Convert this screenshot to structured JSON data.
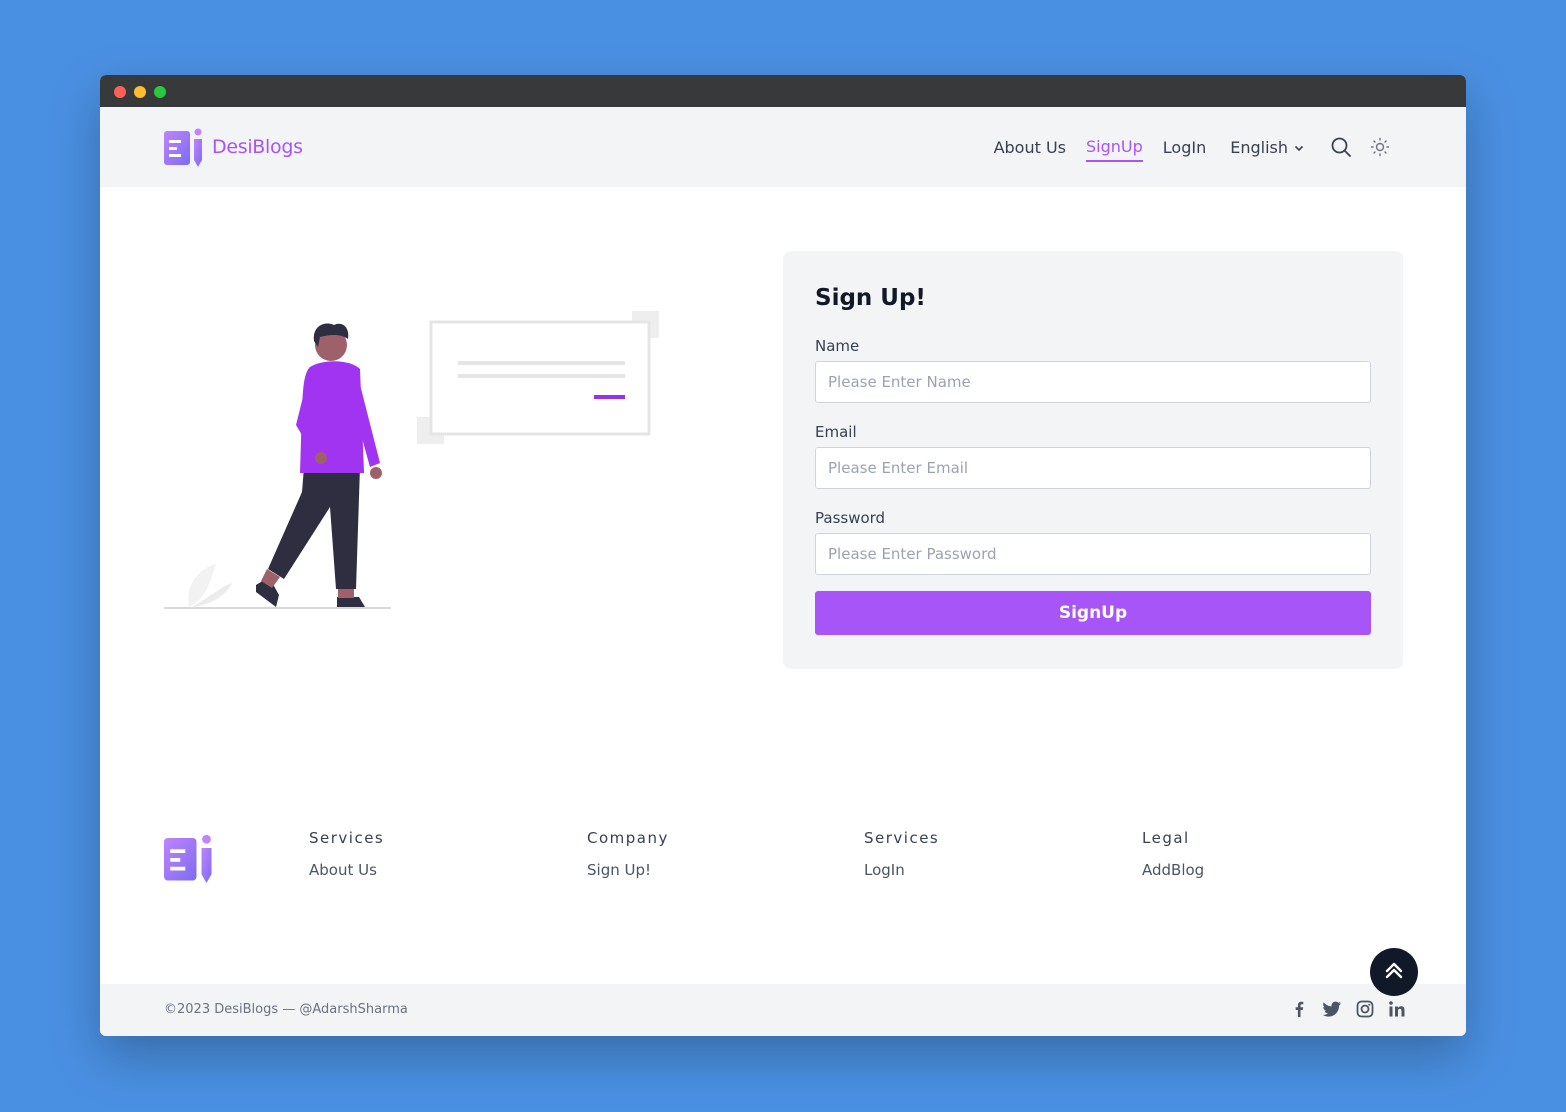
{
  "brand": {
    "name": "DesiBlogs",
    "accent": "#a855f7"
  },
  "nav": {
    "links": [
      "About Us",
      "SignUp",
      "LogIn"
    ],
    "active": "SignUp",
    "language": "English"
  },
  "signup": {
    "title": "Sign Up!",
    "name_label": "Name",
    "name_placeholder": "Please Enter Name",
    "email_label": "Email",
    "email_placeholder": "Please Enter Email",
    "password_label": "Password",
    "password_placeholder": "Please Enter Password",
    "submit_label": "SignUp"
  },
  "footer": {
    "columns": [
      {
        "title": "Services",
        "link": "About Us"
      },
      {
        "title": "Company",
        "link": "Sign Up!"
      },
      {
        "title": "Services",
        "link": "LogIn"
      },
      {
        "title": "Legal",
        "link": "AddBlog"
      }
    ],
    "copyright": "©2023 DesiBlogs — @AdarshSharma",
    "socials": [
      "facebook-icon",
      "twitter-icon",
      "instagram-icon",
      "linkedin-icon"
    ]
  },
  "colors": {
    "page_bg": "#4a90e2",
    "button": "#a855f7",
    "card_bg": "#f3f4f6",
    "scroll_top": "#111827"
  }
}
